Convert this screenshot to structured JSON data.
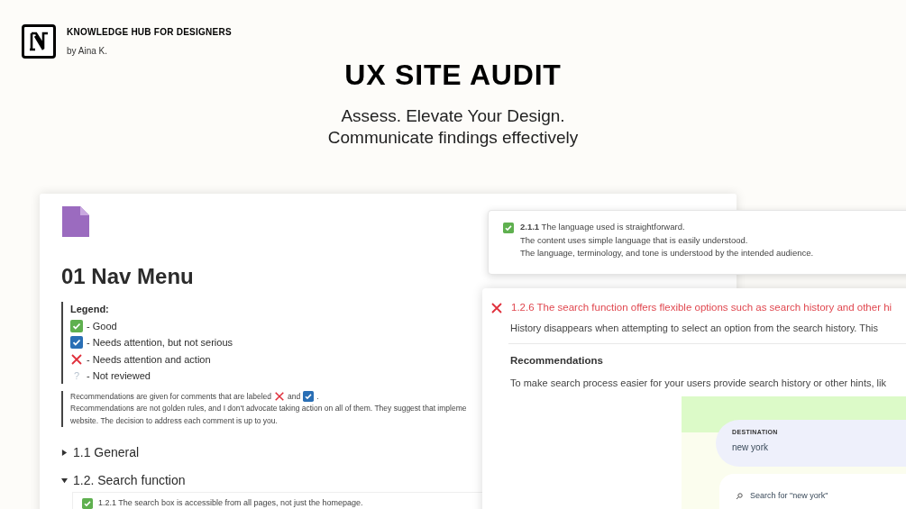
{
  "brand": {
    "title": "KNOWLEDGE HUB FOR DESIGNERS",
    "author": "by Aina K."
  },
  "hero": {
    "title": "UX SITE AUDIT",
    "subtitle_lines": [
      "Assess. Elevate Your Design.",
      "Communicate findings effectively"
    ]
  },
  "page": {
    "title": "01 Nav Menu",
    "legend": {
      "heading": "Legend:",
      "items": [
        {
          "kind": "good",
          "label": "- Good"
        },
        {
          "kind": "minor",
          "label": "- Needs attention, but not serious"
        },
        {
          "kind": "action",
          "label": "- Needs attention and action"
        },
        {
          "kind": "unreviewed",
          "symbol": "?",
          "label": "- Not reviewed"
        }
      ]
    },
    "note": {
      "line1_before": "Recommendations are given for comments that are labeled",
      "line1_middle": "and",
      "line1_after": ".",
      "line2": "Recommendations are not golden rules, and I don't advocate taking action on all of them. They suggest that impleme",
      "line3": "website. The decision to address each comment is up to you."
    },
    "sections": [
      {
        "title": "1.1 General",
        "expanded": false
      },
      {
        "title": "1.2. Search function",
        "expanded": true,
        "items": [
          {
            "kind": "good",
            "text": "1.2.1 The search box is accessible from all pages, not just the homepage."
          }
        ]
      }
    ]
  },
  "finding_card": {
    "kind": "good",
    "number": "2.1.1",
    "title": "The language used is straightforward.",
    "lines": [
      "The content uses simple language that is easily understood.",
      "The language, terminology, and tone is understood by the intended audience."
    ]
  },
  "issue_card": {
    "kind": "action",
    "title": "1.2.6 The search function offers flexible options such as search history and other hi",
    "description": "History disappears when attempting to select an option from the search history. This",
    "rec_heading": "Recommendations",
    "rec_text": "To make search process easier for your users provide search history or other hints, lik",
    "mockup": {
      "field_label": "DESTINATION",
      "field_value": "new york",
      "suggestion": "Search for \"new york\""
    }
  }
}
